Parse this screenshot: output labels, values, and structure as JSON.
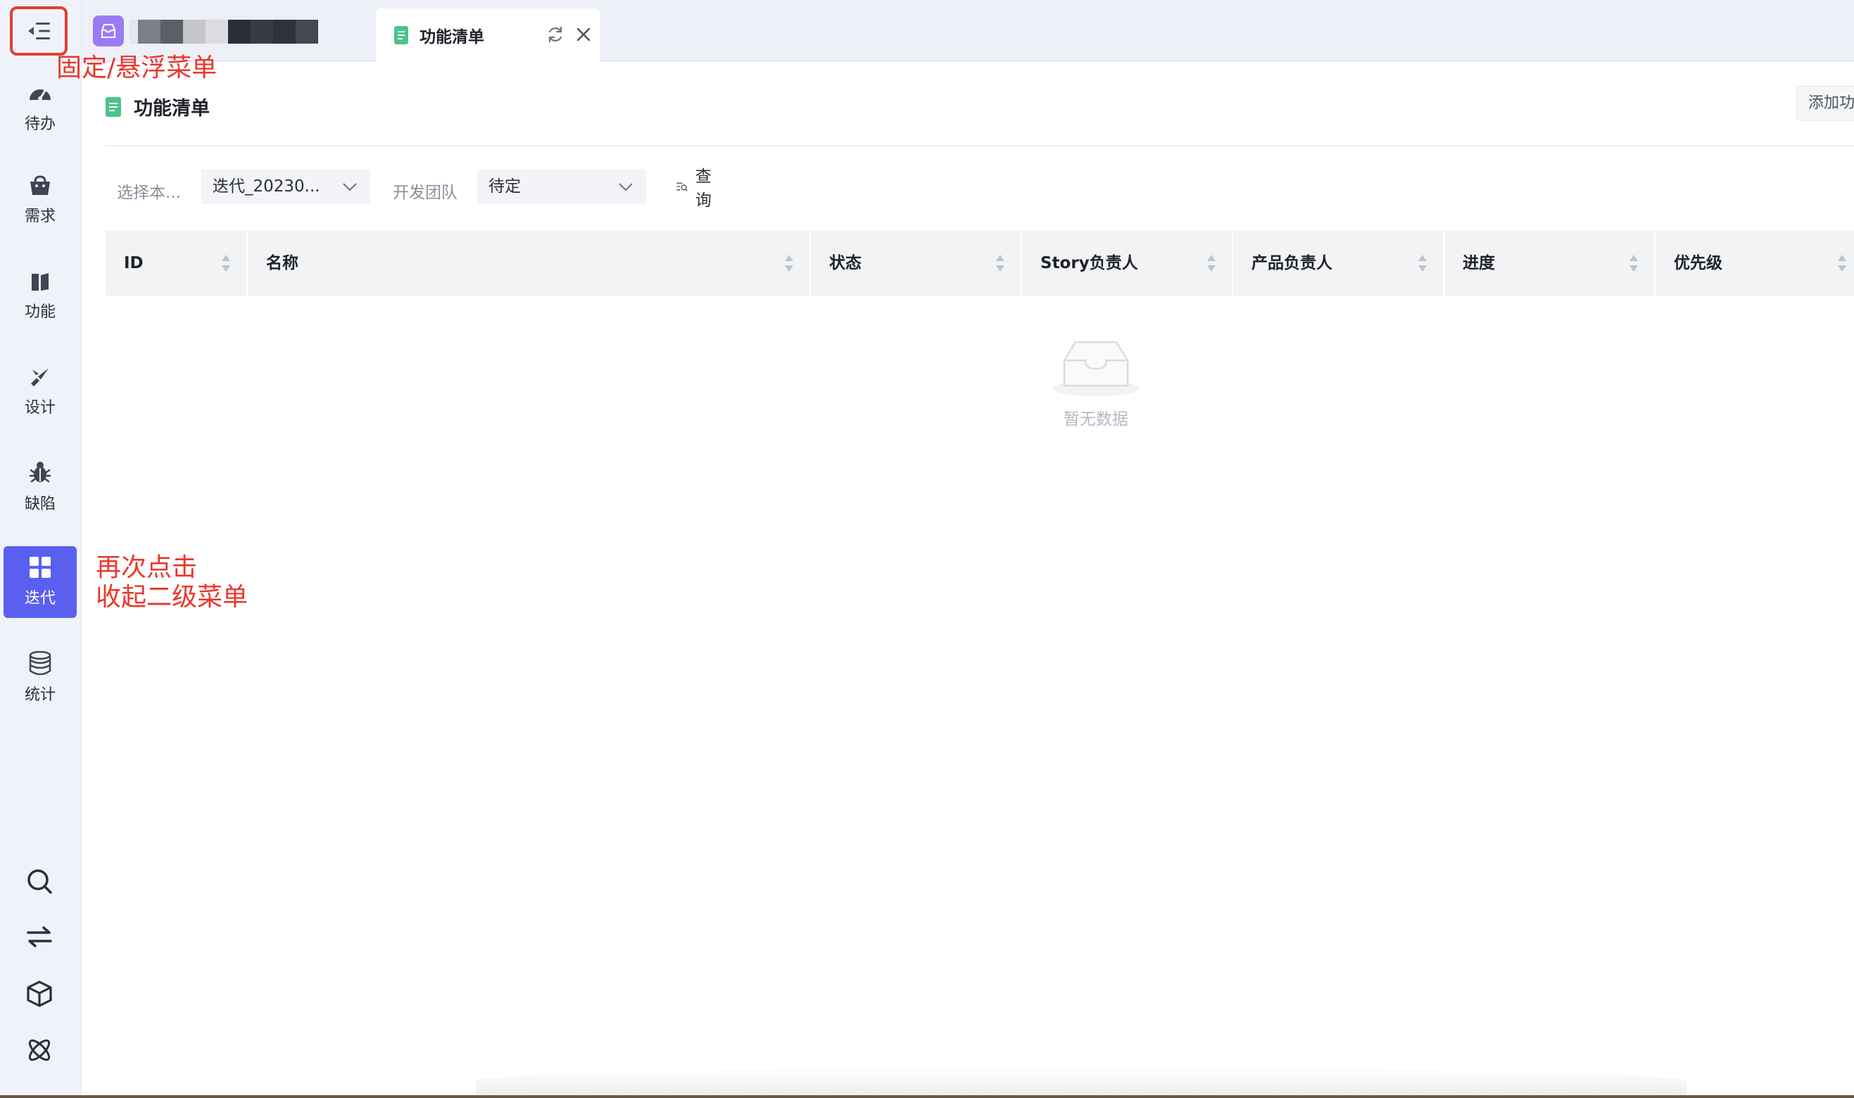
{
  "tab": {
    "label": "功能清单"
  },
  "page": {
    "title": "功能清单",
    "add_button": "添加功"
  },
  "nav": {
    "items": [
      {
        "label": "待办",
        "icon": "gauge-icon"
      },
      {
        "label": "需求",
        "icon": "bag-icon"
      },
      {
        "label": "功能",
        "icon": "book-icon"
      },
      {
        "label": "设计",
        "icon": "design-icon"
      },
      {
        "label": "缺陷",
        "icon": "bug-icon"
      },
      {
        "label": "迭代",
        "icon": "grid-icon"
      },
      {
        "label": "统计",
        "icon": "database-icon"
      }
    ],
    "active": "迭代"
  },
  "tools": [
    "search-icon",
    "switch-icon",
    "cube-icon",
    "atom-icon"
  ],
  "filters": {
    "version_label": "选择本...",
    "version_value": "迭代_20230...",
    "team_label": "开发团队",
    "team_value": "待定",
    "query_label": "查询"
  },
  "table": {
    "columns": [
      "ID",
      "名称",
      "状态",
      "Story负责人",
      "产品负责人",
      "进度",
      "优先级"
    ]
  },
  "empty": {
    "text": "暂无数据"
  },
  "annotations": {
    "pin_menu": "固定/悬浮菜单",
    "collapse_line1": "再次点击",
    "collapse_line2": "收起二级菜单"
  },
  "colors": {
    "accent": "#5b5ff0",
    "annotation": "#e8372c",
    "logo": "#9b7bf4",
    "doc_icon": "#4cc38a"
  }
}
